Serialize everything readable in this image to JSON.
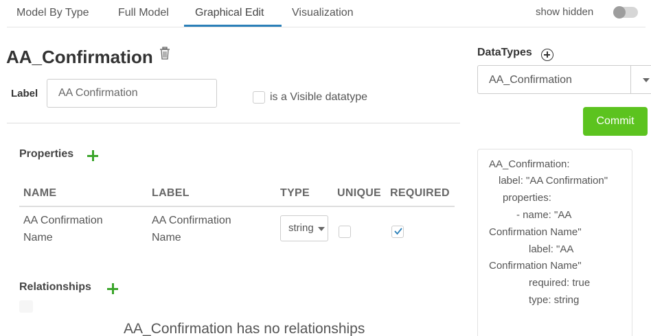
{
  "tabs": [
    {
      "label": "Model By Type",
      "active": false
    },
    {
      "label": "Full Model",
      "active": false
    },
    {
      "label": "Graphical Edit",
      "active": true
    },
    {
      "label": "Visualization",
      "active": false
    }
  ],
  "show_hidden": {
    "label": "show hidden",
    "on": false
  },
  "datatype": {
    "name": "AA_Confirmation",
    "label_field_label": "Label",
    "label_value": "AA Confirmation",
    "visible_checkbox_label": "is a Visible datatype",
    "visible": false
  },
  "properties": {
    "heading": "Properties",
    "columns": [
      "NAME",
      "LABEL",
      "TYPE",
      "UNIQUE",
      "REQUIRED"
    ],
    "rows": [
      {
        "name_line1": "AA Confirmation",
        "name_line2": "Name",
        "label_line1": "AA Confirmation",
        "label_line2": "Name",
        "type": "string",
        "unique": false,
        "required": true
      }
    ]
  },
  "relationships": {
    "heading": "Relationships",
    "empty_message": "AA_Confirmation has no relationships"
  },
  "sidebar": {
    "title": "DataTypes",
    "selected": "AA_Confirmation",
    "commit_label": "Commit",
    "yaml_lines": [
      "AA_Confirmation:",
      "label: \"AA Confirmation\"",
      "properties:",
      "-  name: \"AA",
      "Confirmation Name\"",
      "label: \"AA",
      "Confirmation Name\"",
      "required: true",
      "type: string"
    ]
  },
  "colors": {
    "accent": "#2a7fb8",
    "commit": "#5cc31f",
    "add": "#3aa52a",
    "check": "#2a7fb8"
  }
}
